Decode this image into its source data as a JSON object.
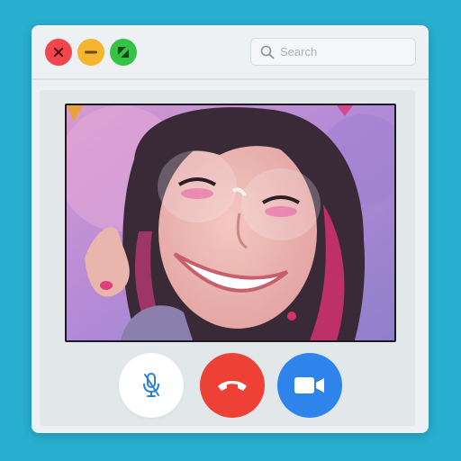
{
  "window": {
    "search": {
      "placeholder": "Search",
      "value": ""
    }
  },
  "controls": {
    "mute": {
      "icon": "microphone-off-icon"
    },
    "end_call": {
      "icon": "phone-hangup-icon"
    },
    "video": {
      "icon": "video-camera-icon"
    }
  },
  "colors": {
    "background": "#28aed0",
    "close": "#f0474f",
    "minimize": "#f5b52e",
    "maximize": "#35c345",
    "end_call": "#ee4136",
    "video": "#2e84ea",
    "mute_icon": "#2e7fd6"
  }
}
